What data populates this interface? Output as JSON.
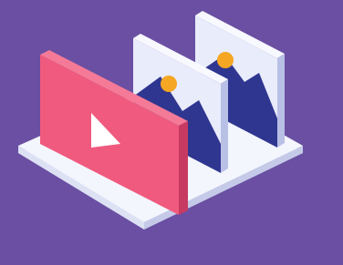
{
  "illustration": {
    "subject": "media-gallery",
    "icons": [
      "video-play-icon",
      "image-icon",
      "image-icon"
    ]
  },
  "colors": {
    "background": "#6a4fa2",
    "platform_top": "#f4f6fd",
    "platform_side": "#cfd4ec",
    "video_panel": "#f05a7e",
    "video_panel_side": "#c83a61",
    "play_triangle": "#ffffff",
    "photo_frame": "#e9ecfb",
    "photo_mountains": "#2f3690",
    "photo_sun": "#f5a623"
  }
}
